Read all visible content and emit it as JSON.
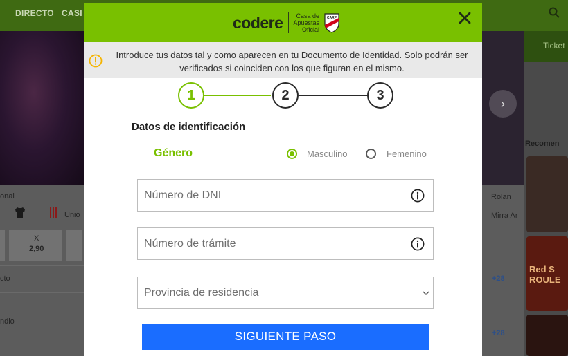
{
  "background": {
    "nav": [
      "DIRECTO",
      "CASI"
    ],
    "right_tab": "Ticket",
    "left_texts": [
      "onal",
      "Unió",
      "X",
      "2,90",
      "cto",
      "ndio"
    ],
    "right_texts": [
      "Rolan",
      "Mirra Ar",
      "+28",
      "+28"
    ],
    "recommended": "Recomen",
    "casino_text": "Red S ROULE"
  },
  "header": {
    "logo": "codere",
    "tagline_line1": "Casa de",
    "tagline_line2": "Apuestas",
    "tagline_line3": "Oficial",
    "partner_badge": "CARP"
  },
  "notice": {
    "text": "Introduce tus datos tal y como aparecen en tu Documento de Identidad. Solo podrán ser verificados si coinciden con los que figuran en el mismo."
  },
  "stepper": {
    "steps": [
      "1",
      "2",
      "3"
    ],
    "active_step": 1
  },
  "form": {
    "section_title": "Datos de identificación",
    "gender_label": "Género",
    "gender_options": [
      "Masculino",
      "Femenino"
    ],
    "gender_selected": "Masculino",
    "dni_placeholder": "Número de DNI",
    "tramite_placeholder": "Número de trámite",
    "province_placeholder": "Provincia de residencia",
    "submit_label": "SIGUIENTE PASO"
  },
  "colors": {
    "brand_green": "#79c000",
    "button_blue": "#1a6dff",
    "notice_icon": "#f5b400"
  }
}
